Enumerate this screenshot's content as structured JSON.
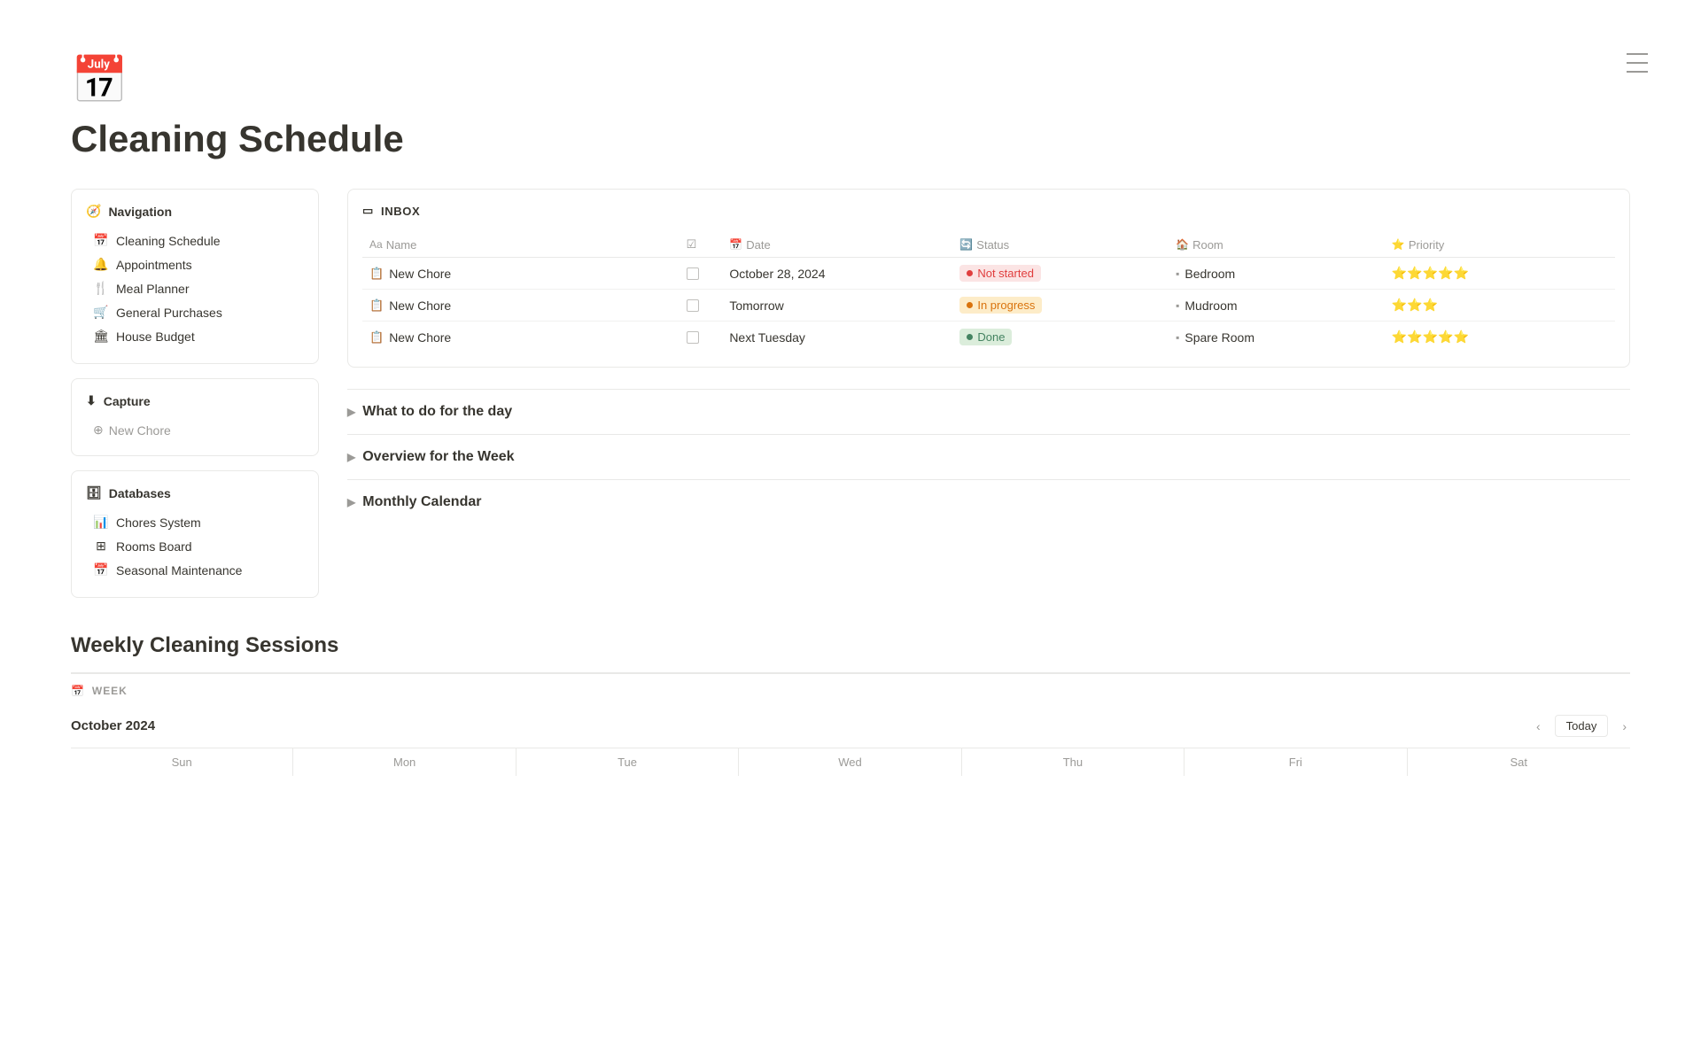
{
  "page": {
    "icon": "📅",
    "title": "Cleaning Schedule"
  },
  "sidebar": {
    "navigation": {
      "header": "Navigation",
      "items": [
        {
          "id": "cleaning-schedule",
          "icon": "📅",
          "label": "Cleaning Schedule"
        },
        {
          "id": "appointments",
          "icon": "🔔",
          "label": "Appointments"
        },
        {
          "id": "meal-planner",
          "icon": "🍴",
          "label": "Meal Planner"
        },
        {
          "id": "general-purchases",
          "icon": "🛒",
          "label": "General Purchases"
        },
        {
          "id": "house-budget",
          "icon": "🏛",
          "label": "House Budget"
        }
      ]
    },
    "capture": {
      "header": "Capture",
      "new_chore_placeholder": "New Chore"
    },
    "databases": {
      "header": "Databases",
      "items": [
        {
          "id": "chores-system",
          "icon": "📊",
          "label": "Chores System"
        },
        {
          "id": "rooms-board",
          "icon": "⊞",
          "label": "Rooms Board"
        },
        {
          "id": "seasonal-maintenance",
          "icon": "📅",
          "label": "Seasonal Maintenance"
        }
      ]
    }
  },
  "inbox": {
    "header": "INBOX",
    "columns": {
      "name": "Name",
      "date": "Date",
      "status": "Status",
      "room": "Room",
      "priority": "Priority"
    },
    "rows": [
      {
        "name": "New Chore",
        "date": "October 28, 2024",
        "status": "Not started",
        "status_type": "not-started",
        "room": "Bedroom",
        "priority": "⭐⭐⭐⭐⭐"
      },
      {
        "name": "New Chore",
        "date": "Tomorrow",
        "status": "In progress",
        "status_type": "in-progress",
        "room": "Mudroom",
        "priority": "⭐⭐⭐"
      },
      {
        "name": "New Chore",
        "date": "Next Tuesday",
        "status": "Done",
        "status_type": "done",
        "room": "Spare Room",
        "priority": "⭐⭐⭐⭐⭐"
      }
    ]
  },
  "sections": [
    {
      "id": "what-to-do",
      "label": "What to do for the day"
    },
    {
      "id": "overview-week",
      "label": "Overview for the Week"
    },
    {
      "id": "monthly-calendar",
      "label": "Monthly Calendar"
    }
  ],
  "weekly": {
    "title": "Weekly Cleaning Sessions",
    "week_label": "WEEK",
    "month": "October 2024",
    "today_btn": "Today",
    "days": [
      "Sun",
      "Mon",
      "Tue",
      "Wed",
      "Thu",
      "Fri",
      "Sat"
    ]
  }
}
